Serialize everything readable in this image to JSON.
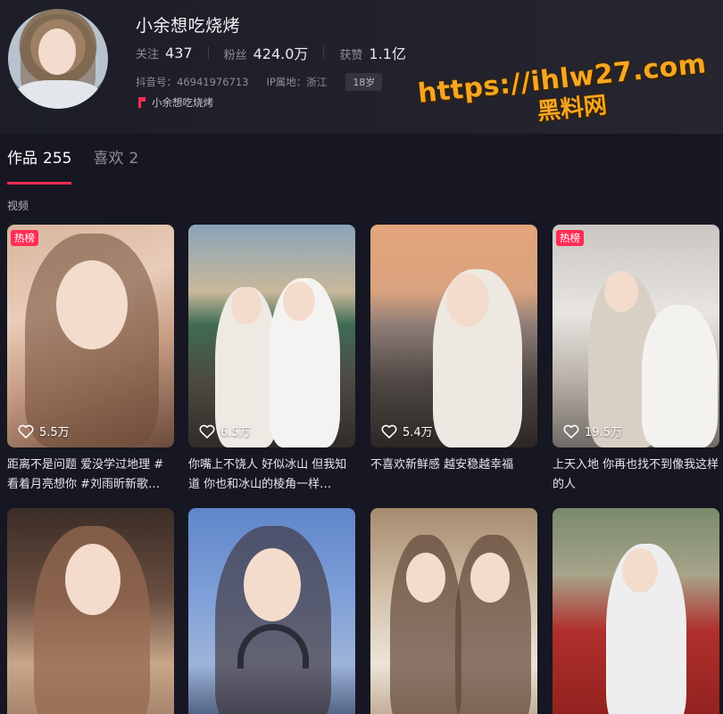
{
  "profile": {
    "nickname": "小余想吃烧烤",
    "stats": [
      {
        "label": "关注",
        "value": "437"
      },
      {
        "label": "粉丝",
        "value": "424.0万"
      },
      {
        "label": "获赞",
        "value": "1.1亿"
      }
    ],
    "douyin_id": "抖音号：46941976713",
    "ip_location": "IP属地：浙江",
    "age": "18岁",
    "tag": "小余想吃烧烤"
  },
  "watermark": {
    "url": "https://ihlw27.com",
    "name": "黑料网"
  },
  "tabs": [
    {
      "label": "作品",
      "count": "255"
    },
    {
      "label": "喜欢",
      "count": "2"
    }
  ],
  "section_label": "视频",
  "videos": [
    {
      "likes": "5.5万",
      "caption": "距离不是问题 爱没学过地理 #看着月亮想你 #刘雨昕新歌…",
      "hot": "热榜"
    },
    {
      "likes": "6.5万",
      "caption": "你嘴上不饶人 好似冰山 但我知道 你也和冰山的棱角一样…",
      "hot": ""
    },
    {
      "likes": "5.4万",
      "caption": "不喜欢新鲜感 越安稳越幸福",
      "hot": ""
    },
    {
      "likes": "19.5万",
      "caption": "上天入地 你再也找不到像我这样的人",
      "hot": "热榜"
    },
    {
      "likes": "",
      "caption": "",
      "hot": ""
    },
    {
      "likes": "",
      "caption": "",
      "hot": ""
    },
    {
      "likes": "",
      "caption": "",
      "hot": ""
    },
    {
      "likes": "",
      "caption": "",
      "hot": ""
    }
  ],
  "colors": {
    "accent": "#fe2c55",
    "background": "#161722",
    "watermark": "#f6a623"
  },
  "icons": [
    "heart-icon",
    "flag-icon"
  ]
}
